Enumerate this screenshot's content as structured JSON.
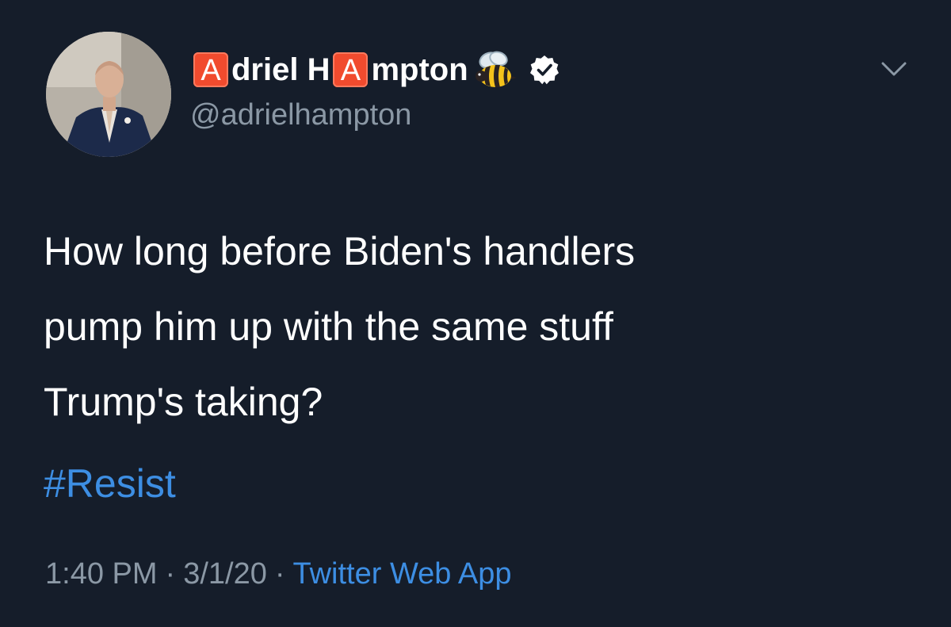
{
  "tweet": {
    "author": {
      "name_parts": [
        "driel H",
        "mpton"
      ],
      "name_badge_letters": [
        "A",
        "A"
      ],
      "emoji": "bee-icon",
      "verified": true,
      "handle": "@adrielhampton"
    },
    "text_lines": [
      "How long before Biden's handlers",
      "pump him up with the same stuff",
      "Trump's taking?"
    ],
    "hashtag": "#Resist",
    "time": "1:40 PM",
    "date": "3/1/20",
    "separator": "·",
    "source": "Twitter Web App"
  },
  "colors": {
    "background": "#151d2a",
    "text": "#ffffff",
    "secondary": "#8b98a5",
    "accent": "#3d8ee3",
    "badge": "#f14b2e"
  }
}
